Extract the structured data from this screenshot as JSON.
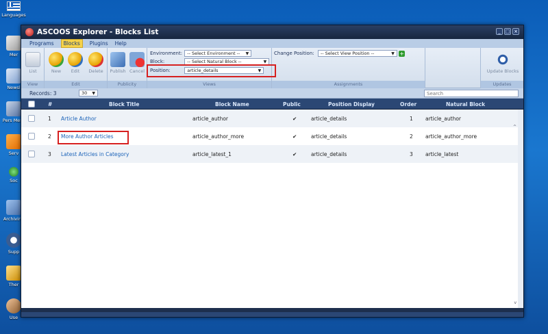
{
  "desktop": {
    "icons": [
      {
        "label": "Languages"
      },
      {
        "label": "Mer"
      },
      {
        "label": "Newsl"
      },
      {
        "label": "Pers Mess"
      },
      {
        "label": "Serv"
      },
      {
        "label": "Soc"
      },
      {
        "label": "Archiving"
      },
      {
        "label": "Supp"
      },
      {
        "label": "Ther"
      },
      {
        "label": "Use"
      }
    ]
  },
  "window": {
    "title": "ASCOOS Explorer - Blocks List",
    "controls": {
      "minimize": "_",
      "maximize": "□",
      "close": "×"
    }
  },
  "menu": {
    "items": [
      "Programs",
      "Blocks",
      "Plugins",
      "Help"
    ],
    "active": "Blocks"
  },
  "toolbar": {
    "view": {
      "buttons": [
        "List"
      ],
      "group_label": "View"
    },
    "edit": {
      "buttons": [
        "New",
        "Edit",
        "Delete"
      ],
      "group_label": "Edit"
    },
    "publicity": {
      "buttons": [
        "Publish",
        "Cancel"
      ],
      "group_label": "Publicity"
    },
    "views": {
      "group_label": "Views",
      "environment_label": "Environment:",
      "environment_value": "-- Select Environment --",
      "block_label": "Block:",
      "block_value": "-- Select Natural Block --",
      "position_label": "Position:",
      "position_value": "article_details"
    },
    "assignments": {
      "group_label": "Assignments",
      "change_position_label": "Change Position:",
      "change_position_value": "-- Select View Position --"
    },
    "updates": {
      "button": "Update Blocks",
      "group_label": "Updates"
    }
  },
  "records": {
    "label": "Records: 3",
    "page_size": "30",
    "search_placeholder": "Search"
  },
  "grid": {
    "columns": [
      "#",
      "Block Title",
      "Block Name",
      "Public",
      "Position Display",
      "Order",
      "Natural Block"
    ],
    "rows": [
      {
        "num": "1",
        "title": "Article Author",
        "name": "article_author",
        "public": "✔",
        "position": "article_details",
        "order": "1",
        "natural": "article_author"
      },
      {
        "num": "2",
        "title": "More Author Articles",
        "name": "article_author_more",
        "public": "✔",
        "position": "article_details",
        "order": "2",
        "natural": "article_author_more"
      },
      {
        "num": "3",
        "title": "Latest Articles in Category",
        "name": "article_latest_1",
        "public": "✔",
        "position": "article_details",
        "order": "3",
        "natural": "article_latest"
      }
    ]
  },
  "colors": {
    "desktop_bg": "#1a77cf",
    "window_frame": "#1d2f4d",
    "header_bg": "#2b4774",
    "highlight": "#d61f1f",
    "active_menu": "#f5d24a"
  }
}
